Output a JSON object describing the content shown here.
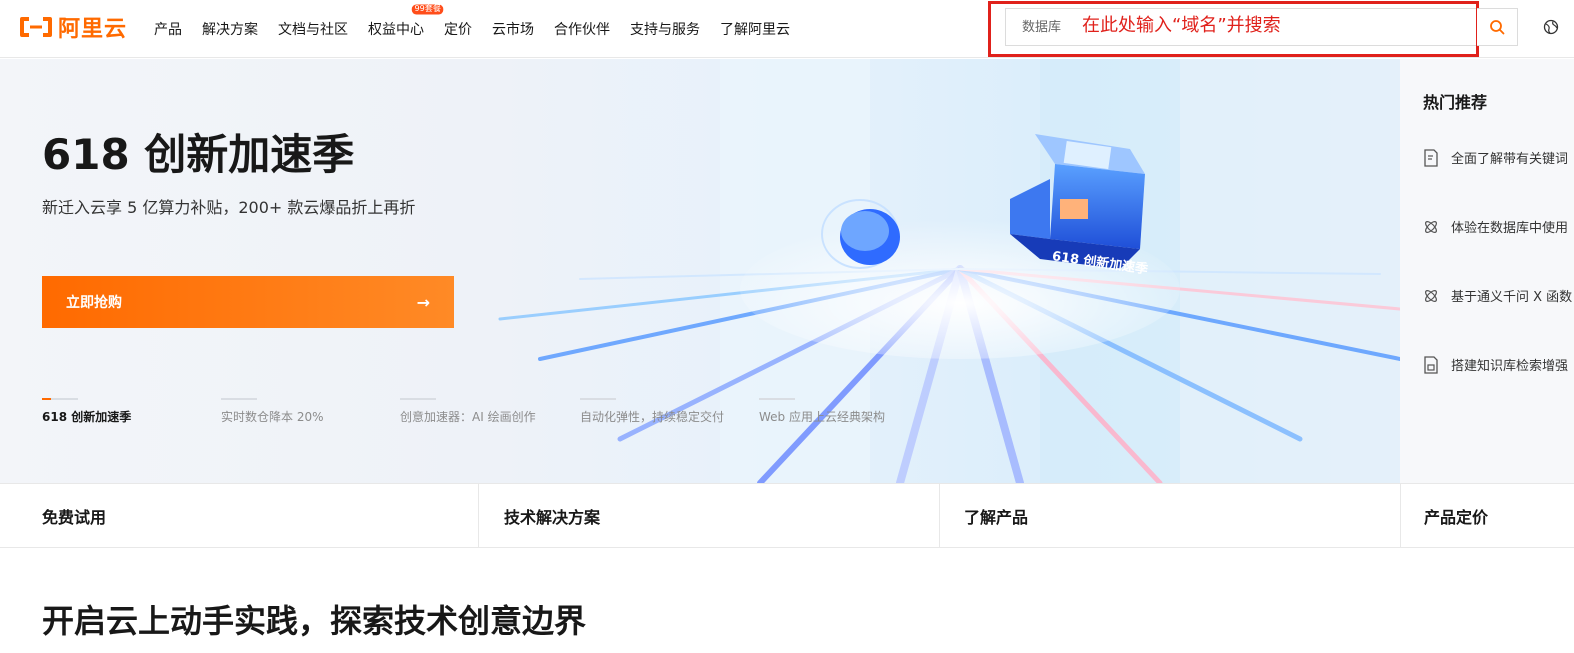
{
  "header": {
    "logo_text": "阿里云",
    "brand_color": "#ff6a00",
    "nav": [
      {
        "label": "产品"
      },
      {
        "label": "解决方案"
      },
      {
        "label": "文档与社区"
      },
      {
        "label": "权益中心",
        "badge": "99套餐"
      },
      {
        "label": "定价"
      },
      {
        "label": "云市场"
      },
      {
        "label": "合作伙伴"
      },
      {
        "label": "支持与服务"
      },
      {
        "label": "了解阿里云"
      }
    ],
    "search": {
      "placeholder": "数据库",
      "annotation": "在此处输入“域名”并搜索",
      "annotation_color": "#e0211b"
    },
    "icons": {
      "search": "search-icon",
      "language": "globe-icon"
    }
  },
  "hero": {
    "title": "618 创新加速季",
    "subtitle": "新迁入云享 5 亿算力补贴，200+ 款云爆品折上再折",
    "cta_label": "立即抢购",
    "art_badge": "618 创新加速季",
    "slides": [
      {
        "label": "618 创新加速季",
        "active": true
      },
      {
        "label": "实时数仓降本 20%",
        "active": false
      },
      {
        "label": "创意加速器：AI 绘画创作",
        "active": false
      },
      {
        "label": "自动化弹性，持续稳定交付",
        "active": false
      },
      {
        "label": "Web 应用上云经典架构",
        "active": false
      }
    ]
  },
  "hot": {
    "title": "热门推荐",
    "items": [
      {
        "icon": "document-icon",
        "label": "全面了解带有关键词"
      },
      {
        "icon": "ai-icon",
        "label": "体验在数据库中使用"
      },
      {
        "icon": "ai-icon",
        "label": "基于通义千问 X 函数"
      },
      {
        "icon": "document-icon",
        "label": "搭建知识库检索增强"
      }
    ]
  },
  "categories": [
    "免费试用",
    "技术解决方案",
    "了解产品",
    "产品定价"
  ],
  "section": {
    "title": "开启云上动手实践，探索技术创意边界"
  }
}
